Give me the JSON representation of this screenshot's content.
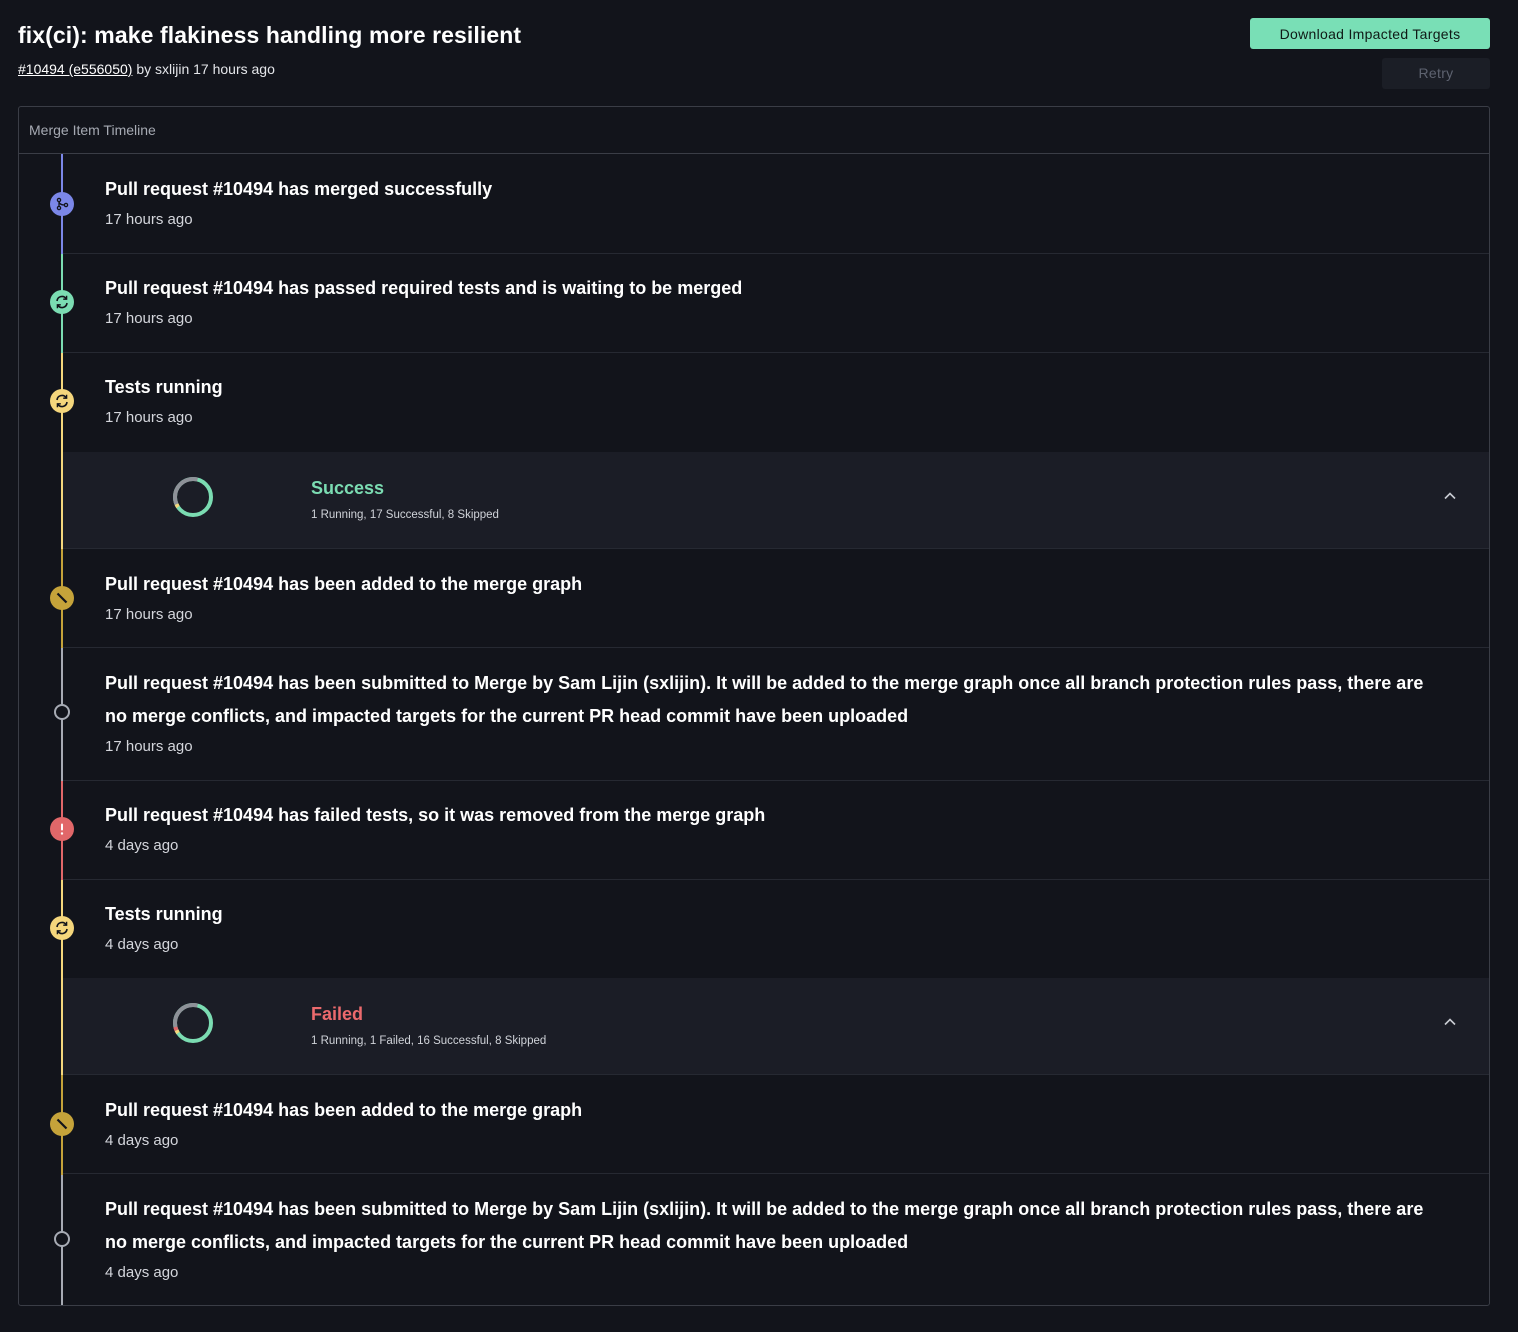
{
  "header": {
    "title": "fix(ci): make flakiness handling more resilient",
    "pr_link": "#10494 (e556050)",
    "by_text": "by sxlijin 17 hours ago"
  },
  "actions": {
    "download_label": "Download Impacted Targets",
    "retry_label": "Retry"
  },
  "panel": {
    "title": "Merge Item Timeline"
  },
  "colors": {
    "merged": "#7b87e8",
    "passed": "#7bdcb2",
    "running": "#f4d67c",
    "added": "#c5a33a",
    "submitted": "#a7abb4",
    "failed": "#e16769",
    "success_text": "#7bdcb2",
    "failed_text": "#ec6a6d"
  },
  "timeline": {
    "items": [
      {
        "title": "Pull request #10494 has merged successfully",
        "time": "17 hours ago",
        "icon": "merge-icon",
        "status": "merged"
      },
      {
        "title": "Pull request #10494 has passed required tests and is waiting to be merged",
        "time": "17 hours ago",
        "icon": "sync-icon",
        "status": "passed"
      },
      {
        "title": "Tests running",
        "time": "17 hours ago",
        "icon": "sync-icon",
        "status": "running",
        "summary": {
          "label": "Success",
          "details": "1 Running, 17 Successful, 8 Skipped",
          "running": 1,
          "failed": 0,
          "successful": 17,
          "skipped": 8
        }
      },
      {
        "title": "Pull request #10494 has been added to the merge graph",
        "time": "17 hours ago",
        "icon": "slash-icon",
        "status": "added"
      },
      {
        "title": "Pull request #10494 has been submitted to Merge by Sam Lijin (sxlijin). It will be added to the merge graph once all branch protection rules pass, there are no merge conflicts, and impacted targets for the current PR head commit have been uploaded",
        "time": "17 hours ago",
        "icon": "circle-icon",
        "status": "submitted"
      },
      {
        "title": "Pull request #10494 has failed tests, so it was removed from the merge graph",
        "time": "4 days ago",
        "icon": "alert-icon",
        "status": "failed"
      },
      {
        "title": "Tests running",
        "time": "4 days ago",
        "icon": "sync-icon",
        "status": "running",
        "summary": {
          "label": "Failed",
          "details": "1 Running, 1 Failed, 16 Successful, 8 Skipped",
          "running": 1,
          "failed": 1,
          "successful": 16,
          "skipped": 8
        }
      },
      {
        "title": "Pull request #10494 has been added to the merge graph",
        "time": "4 days ago",
        "icon": "slash-icon",
        "status": "added"
      },
      {
        "title": "Pull request #10494 has been submitted to Merge by Sam Lijin (sxlijin). It will be added to the merge graph once all branch protection rules pass, there are no merge conflicts, and impacted targets for the current PR head commit have been uploaded",
        "time": "4 days ago",
        "icon": "circle-icon",
        "status": "submitted"
      }
    ]
  }
}
